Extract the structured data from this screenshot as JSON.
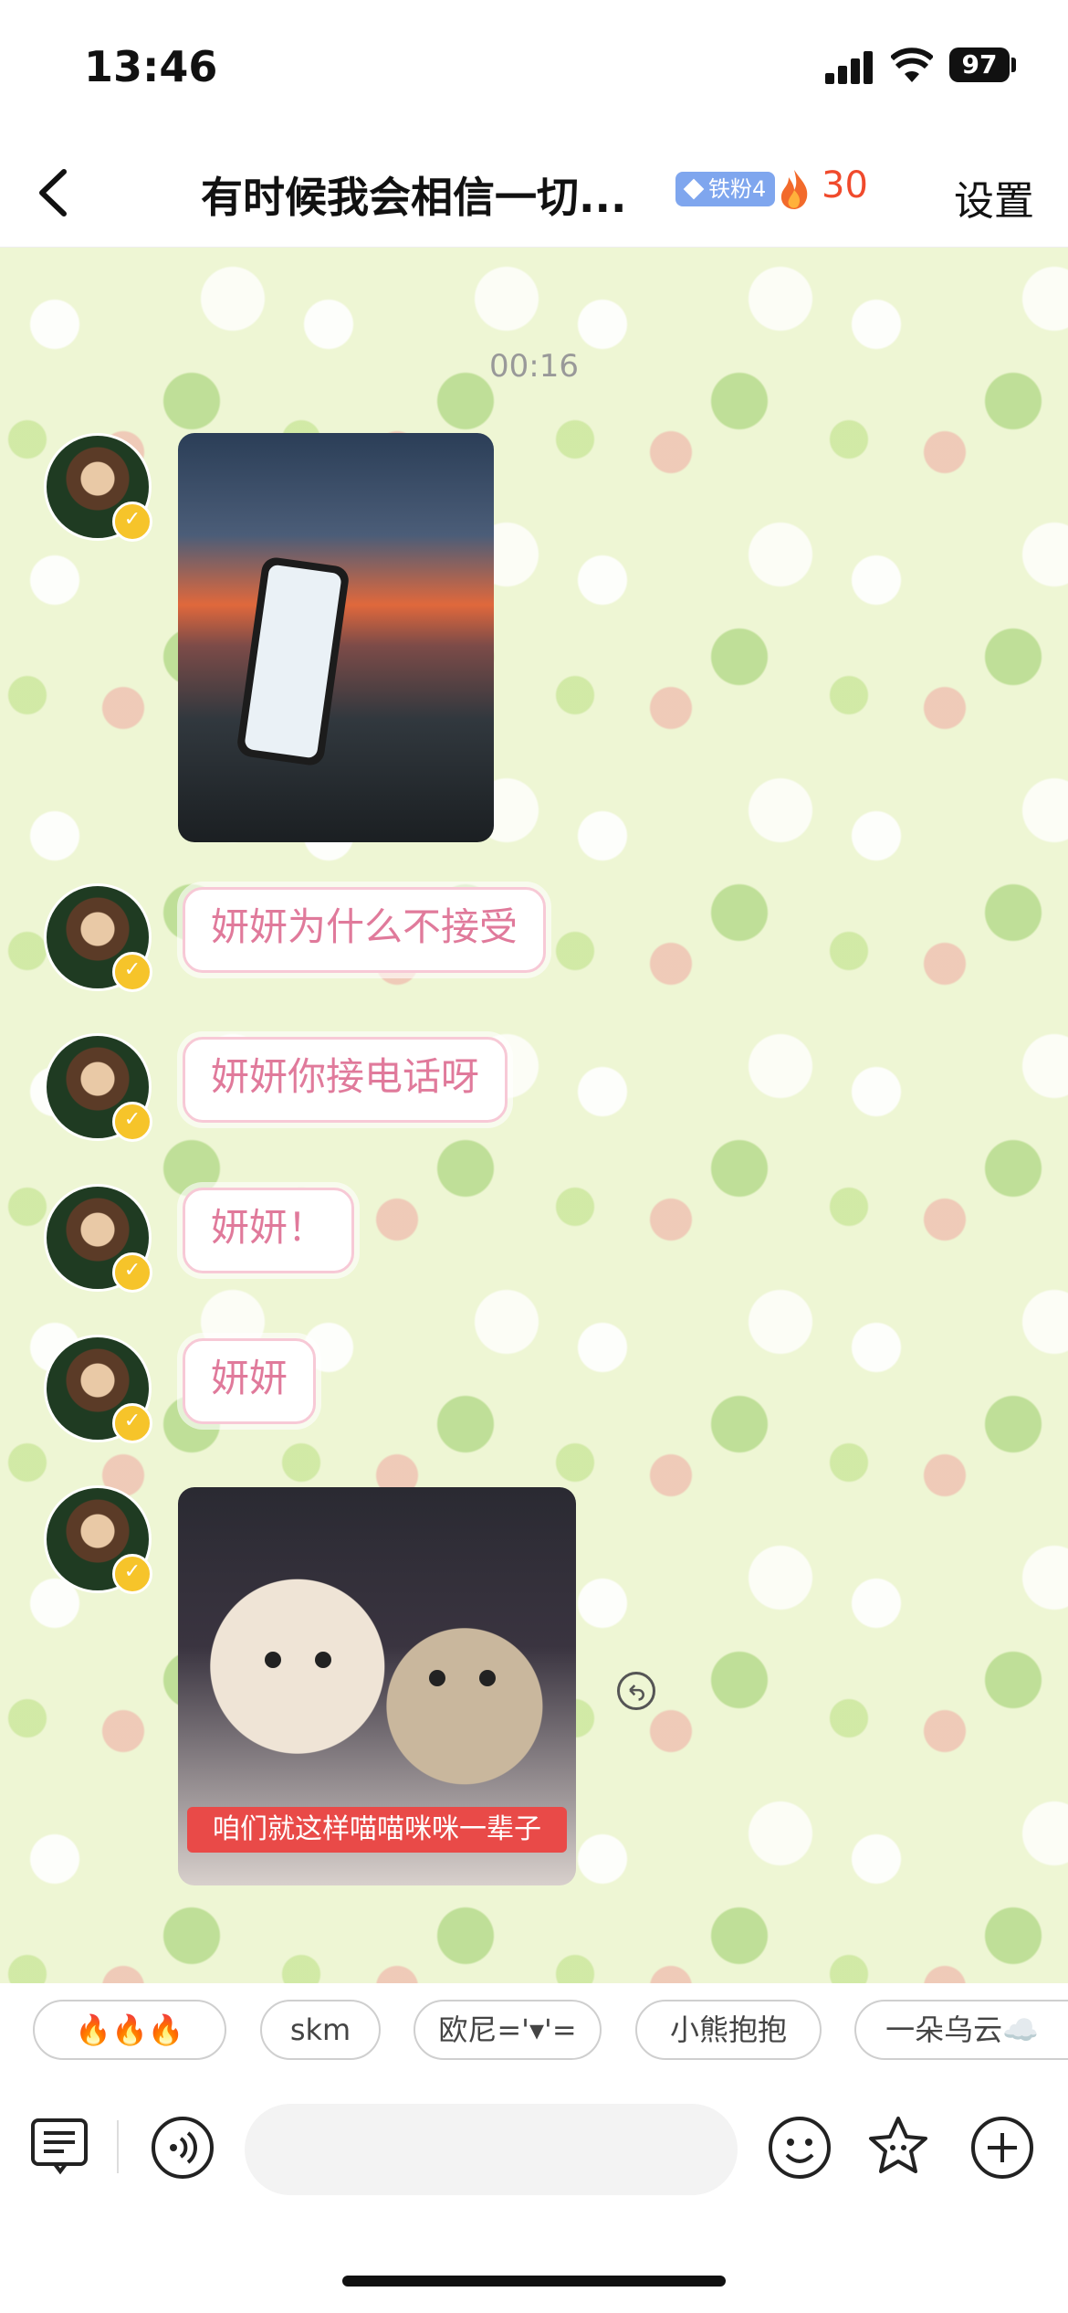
{
  "status_bar": {
    "time": "13:46",
    "battery": "97"
  },
  "nav": {
    "title": "有时候我会相信一切...",
    "fan_badge": "铁粉4",
    "fire_count": "30",
    "settings_label": "设置"
  },
  "chat": {
    "timestamp": "00:16",
    "messages": [
      {
        "type": "image",
        "description_icon": "photo-sunset-phone"
      },
      {
        "type": "text",
        "text": "妍妍为什么不接受"
      },
      {
        "type": "text",
        "text": "妍妍你接电话呀"
      },
      {
        "type": "text",
        "text": "妍妍！"
      },
      {
        "type": "text",
        "text": "妍妍"
      },
      {
        "type": "image",
        "caption": "咱们就这样喵喵咪咪一辈子"
      }
    ]
  },
  "quick_replies": [
    "🔥🔥🔥",
    "skm",
    "欧尼='▾'=",
    "小熊抱抱",
    "一朵乌云☁️"
  ],
  "colors": {
    "accent_pink": "#e07a9b",
    "fire": "#f04a2c",
    "fan_badge": "#7fa6ee",
    "chat_bg": "#eef6d4"
  }
}
